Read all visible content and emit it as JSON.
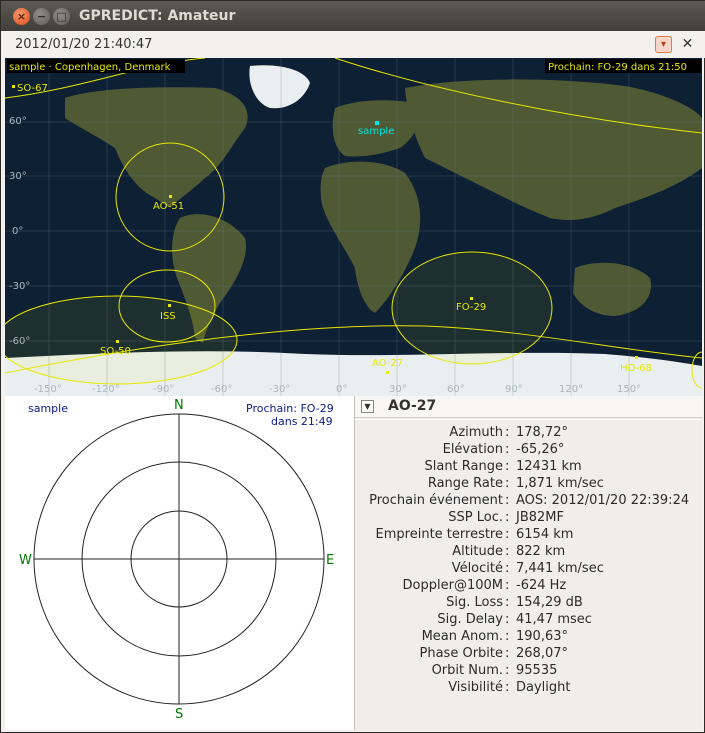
{
  "window": {
    "title": "GPREDICT: Amateur"
  },
  "toolbar": {
    "clock": "2012/01/20 21:40:47",
    "menu_glyph": "▾",
    "close_glyph": "✕"
  },
  "map": {
    "qth_label": "sample · Copenhagen, Denmark",
    "next_label": "Prochain: FO-29 dans 21:50",
    "lat_labels": [
      "60°",
      "30°",
      "0°",
      "-30°",
      "-60°"
    ],
    "lon_labels": [
      "-150°",
      "-120°",
      "-90°",
      "-60°",
      "-30°",
      "0°",
      "30°",
      "60°",
      "90°",
      "120°",
      "150°"
    ],
    "satellites": [
      "SO-67",
      "AO-51",
      "ISS",
      "SO-50",
      "AO-27",
      "FO-29",
      "HO-68"
    ],
    "station": "sample",
    "colors": {
      "sat": "#e8e800",
      "station": "#00e5e5",
      "ocean": "#0e2034",
      "grid": "#6a7a88"
    }
  },
  "polar": {
    "station": "sample",
    "next_line1": "Prochain: FO-29",
    "next_line2": "dans 21:49",
    "north": "N",
    "south": "S",
    "east": "E",
    "west": "W"
  },
  "info": {
    "dropdown_glyph": "▼",
    "satellite": "AO-27",
    "rows": [
      {
        "label": "Azimuth",
        "value": "178,72°"
      },
      {
        "label": "Elévation",
        "value": "-65,26°"
      },
      {
        "label": "Slant Range",
        "value": "12431 km"
      },
      {
        "label": "Range Rate",
        "value": "1,871 km/sec"
      },
      {
        "label": "Prochain événement",
        "value": "AOS: 2012/01/20 22:39:24"
      },
      {
        "label": "SSP Loc.",
        "value": "JB82MF"
      },
      {
        "label": "Empreinte terrestre",
        "value": "6154 km"
      },
      {
        "label": "Altitude",
        "value": "822 km"
      },
      {
        "label": "Vélocité",
        "value": "7,441 km/sec"
      },
      {
        "label": "Doppler@100M",
        "value": "-624 Hz"
      },
      {
        "label": "Sig. Loss",
        "value": "154,29 dB"
      },
      {
        "label": "Sig. Delay",
        "value": "41,47 msec"
      },
      {
        "label": "Mean Anom.",
        "value": "190,63°"
      },
      {
        "label": "Phase Orbite",
        "value": "268,07°"
      },
      {
        "label": "Orbit Num.",
        "value": "95535"
      },
      {
        "label": "Visibilité",
        "value": "Daylight"
      }
    ]
  }
}
